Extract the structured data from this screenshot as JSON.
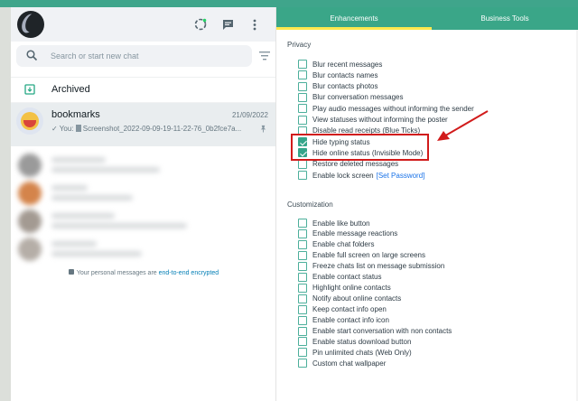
{
  "chat_panel": {
    "header": {
      "icons": [
        "status-icon",
        "new-chat-icon",
        "menu-icon"
      ],
      "status_color": "#25d366"
    },
    "search": {
      "placeholder": "Search or start new chat"
    },
    "archived": {
      "label": "Archived"
    },
    "chat": {
      "title": "bookmarks",
      "date": "21/09/2022",
      "preview_prefix": "✓ You: ",
      "preview": "Screenshot_2022-09-09-19-11-22-76_0b2fce7a..."
    },
    "encryption": {
      "text": "Your personal messages are ",
      "link": "end-to-end encrypted"
    }
  },
  "settings": {
    "tabs": {
      "enhancements": "Enhancements",
      "business_tools": "Business Tools"
    },
    "privacy": {
      "title": "Privacy",
      "options": [
        {
          "label": "Blur recent messages",
          "checked": false
        },
        {
          "label": "Blur contacts names",
          "checked": false
        },
        {
          "label": "Blur contacts photos",
          "checked": false
        },
        {
          "label": "Blur conversation messages",
          "checked": false
        },
        {
          "label": "Play audio messages without informing the sender",
          "checked": false
        },
        {
          "label": "View statuses without informing the poster",
          "checked": false
        },
        {
          "label": "Disable read receipts (Blue Ticks)",
          "checked": false
        },
        {
          "label": "Hide typing status",
          "checked": true
        },
        {
          "label": "Hide online status (Invisible Mode)",
          "checked": true
        },
        {
          "label": "Restore deleted messages",
          "checked": false
        },
        {
          "label": "Enable lock screen",
          "checked": false,
          "link": "[Set Password]"
        }
      ]
    },
    "customization": {
      "title": "Customization",
      "options": [
        {
          "label": "Enable like button",
          "checked": false
        },
        {
          "label": "Enable message reactions",
          "checked": false
        },
        {
          "label": "Enable chat folders",
          "checked": false
        },
        {
          "label": "Enable full screen on large screens",
          "checked": false
        },
        {
          "label": "Freeze chats list on message submission",
          "checked": false
        },
        {
          "label": "Enable contact status",
          "checked": false
        },
        {
          "label": "Highlight online contacts",
          "checked": false
        },
        {
          "label": "Notify about online contacts",
          "checked": false
        },
        {
          "label": "Keep contact info open",
          "checked": false
        },
        {
          "label": "Enable contact info icon",
          "checked": false
        },
        {
          "label": "Enable start conversation with non contacts",
          "checked": false
        },
        {
          "label": "Enable status download button",
          "checked": false
        },
        {
          "label": "Pin unlimited chats (Web Only)",
          "checked": false
        },
        {
          "label": "Custom chat wallpaper",
          "checked": false
        }
      ]
    },
    "colors": {
      "accent": "#3aa688",
      "tab_indicator": "#fde84e",
      "annotation": "#d11b1b"
    }
  }
}
